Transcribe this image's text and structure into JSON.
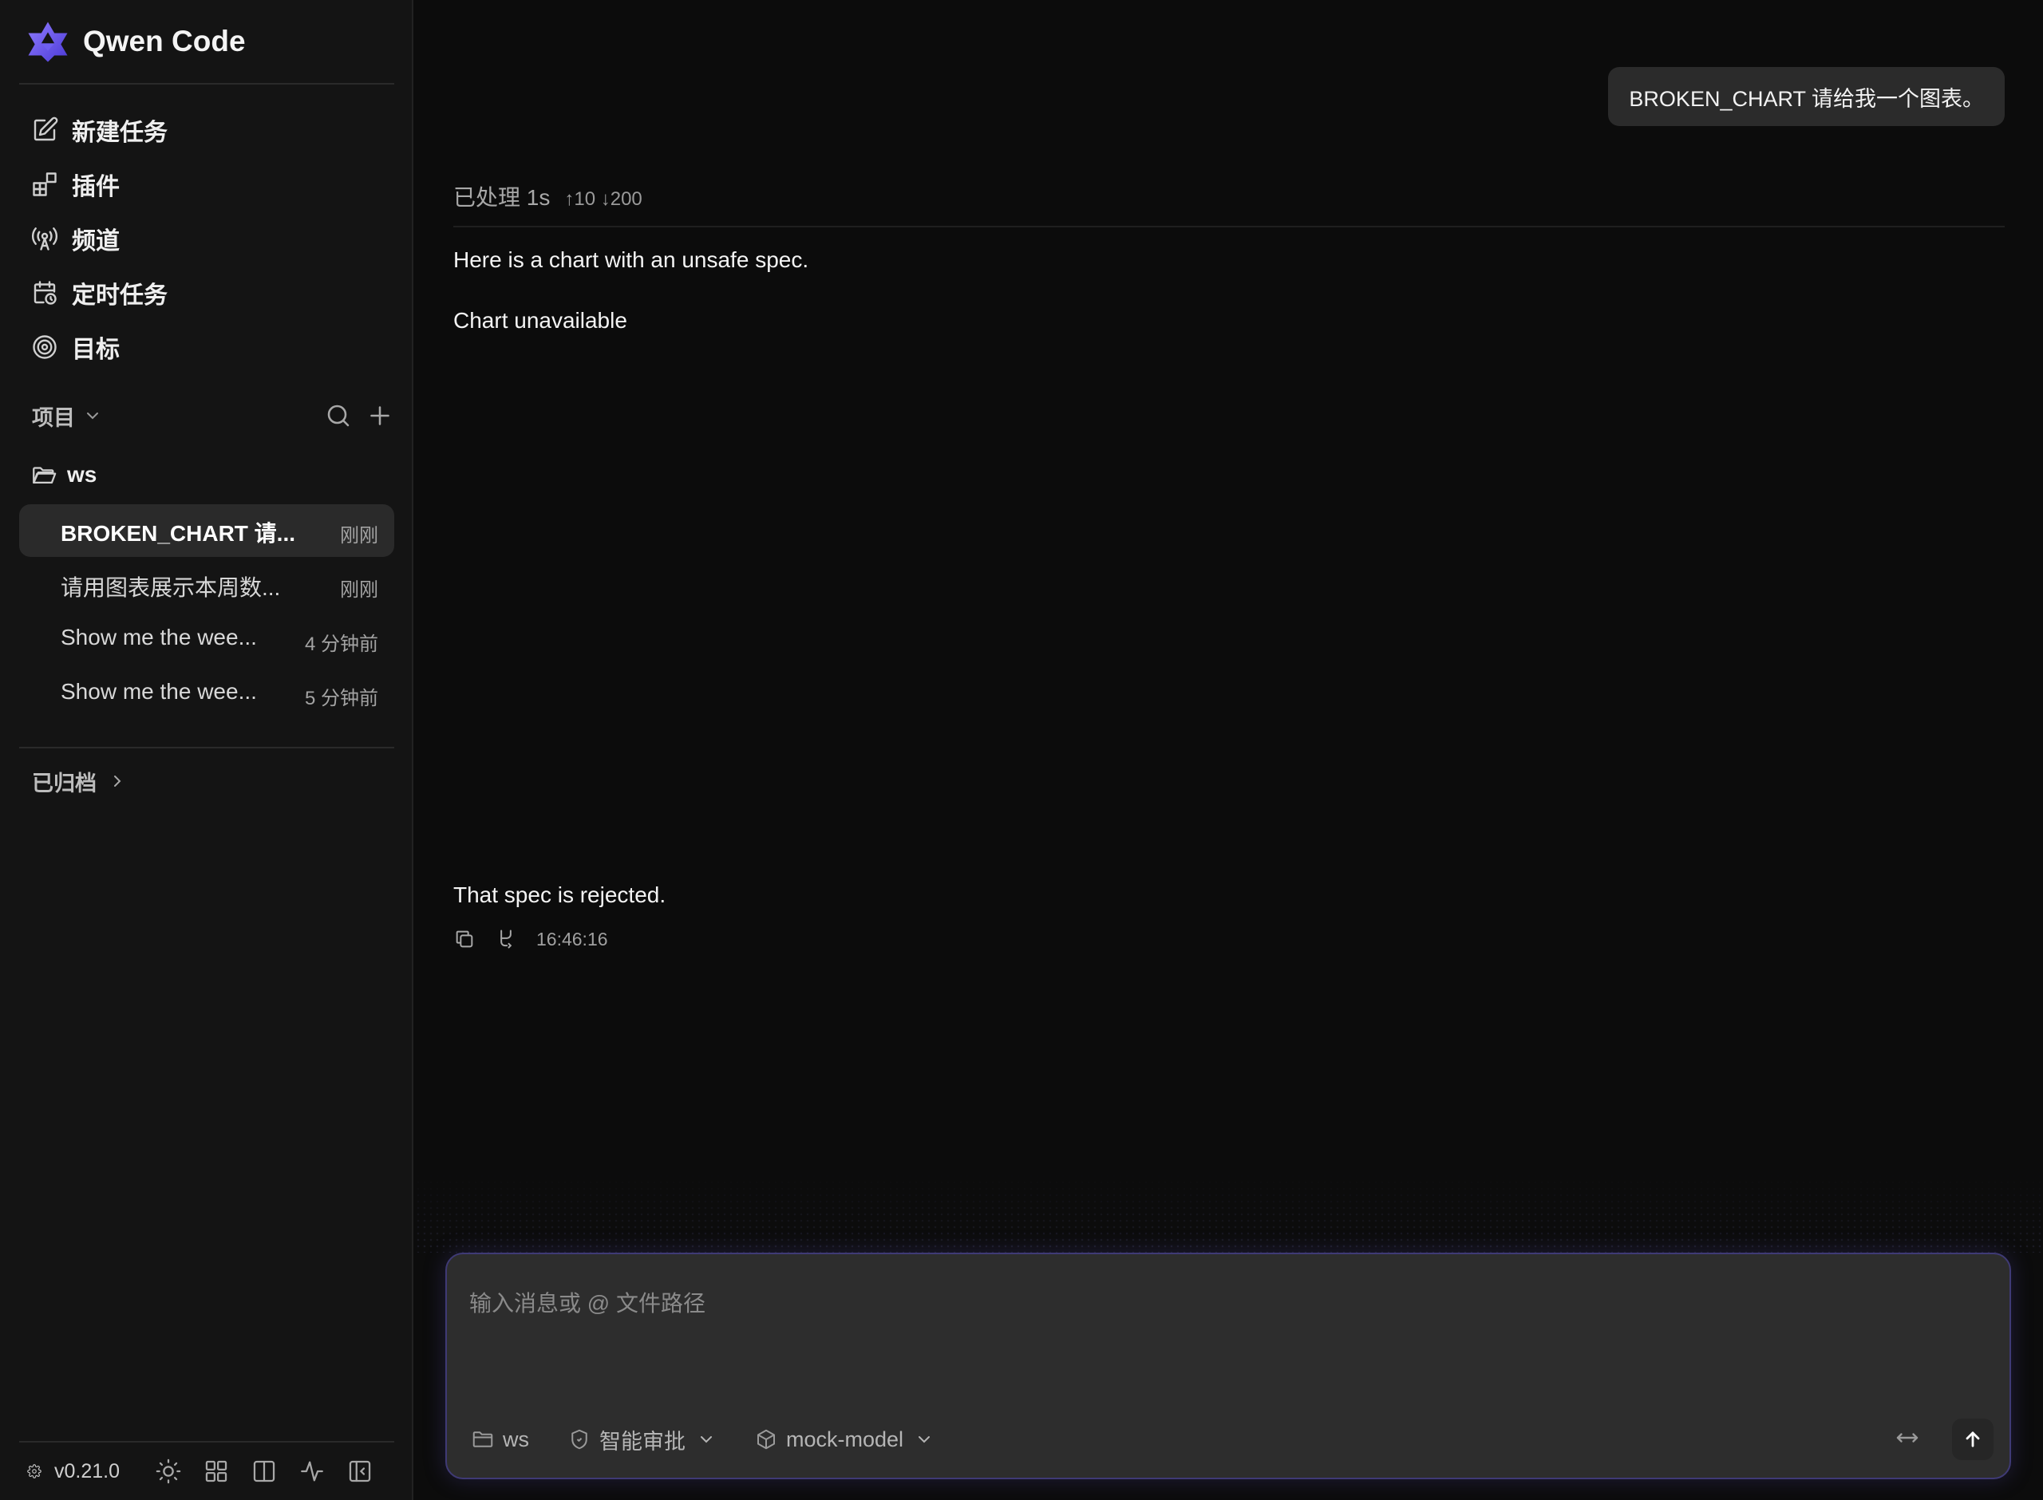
{
  "app": {
    "title": "Qwen Code",
    "version": "v0.21.0",
    "accent": "#6b5cff"
  },
  "nav": {
    "items": [
      {
        "label": "新建任务",
        "icon": "new-task-icon"
      },
      {
        "label": "插件",
        "icon": "plugin-icon"
      },
      {
        "label": "频道",
        "icon": "channel-icon"
      },
      {
        "label": "定时任务",
        "icon": "scheduled-task-icon"
      },
      {
        "label": "目标",
        "icon": "target-icon"
      }
    ]
  },
  "projects": {
    "label": "项目",
    "folder": "ws",
    "sessions": [
      {
        "title": "BROKEN_CHART 请...",
        "time": "刚刚",
        "active": true
      },
      {
        "title": "请用图表展示本周数...",
        "time": "刚刚",
        "active": false
      },
      {
        "title": "Show me the wee...",
        "time": "4 分钟前",
        "active": false
      },
      {
        "title": "Show me the wee...",
        "time": "5 分钟前",
        "active": false
      }
    ]
  },
  "archived": {
    "label": "已归档"
  },
  "chat": {
    "user_message": "BROKEN_CHART 请给我一个图表。",
    "processed": "已处理 1s",
    "tokens": "↑10 ↓200",
    "assistant_text_1": "Here is a chart with an unsafe spec.",
    "assistant_text_2": "Chart unavailable",
    "assistant_text_3": "That spec is rejected.",
    "timestamp": "16:46:16"
  },
  "composer": {
    "placeholder": "输入消息或 @ 文件路径",
    "folder": "ws",
    "approval": "智能审批",
    "model": "mock-model"
  }
}
